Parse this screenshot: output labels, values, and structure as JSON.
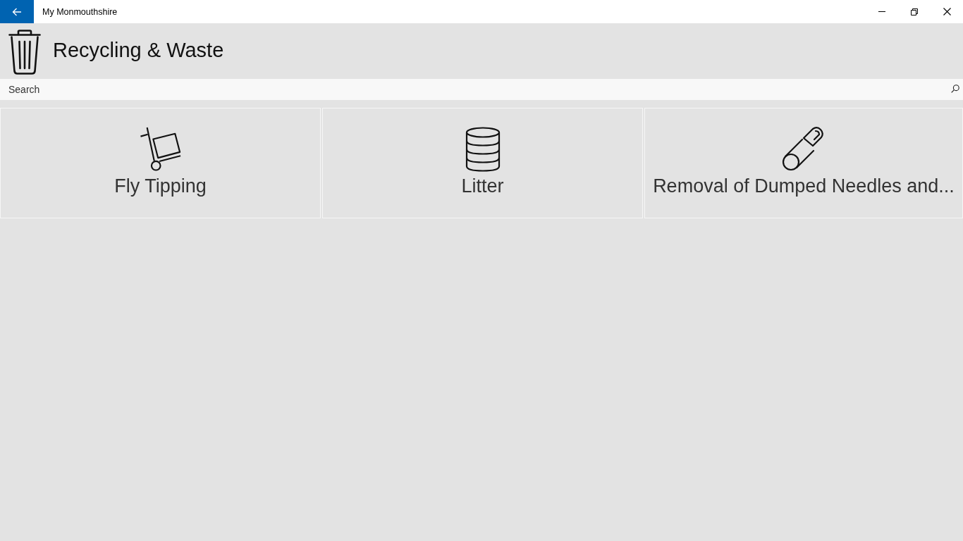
{
  "window": {
    "title": "My Monmouthshire"
  },
  "header": {
    "title": "Recycling & Waste"
  },
  "search": {
    "placeholder": "Search"
  },
  "tiles": [
    {
      "label": "Fly Tipping"
    },
    {
      "label": "Litter"
    },
    {
      "label": "Removal of Dumped Needles and..."
    }
  ]
}
